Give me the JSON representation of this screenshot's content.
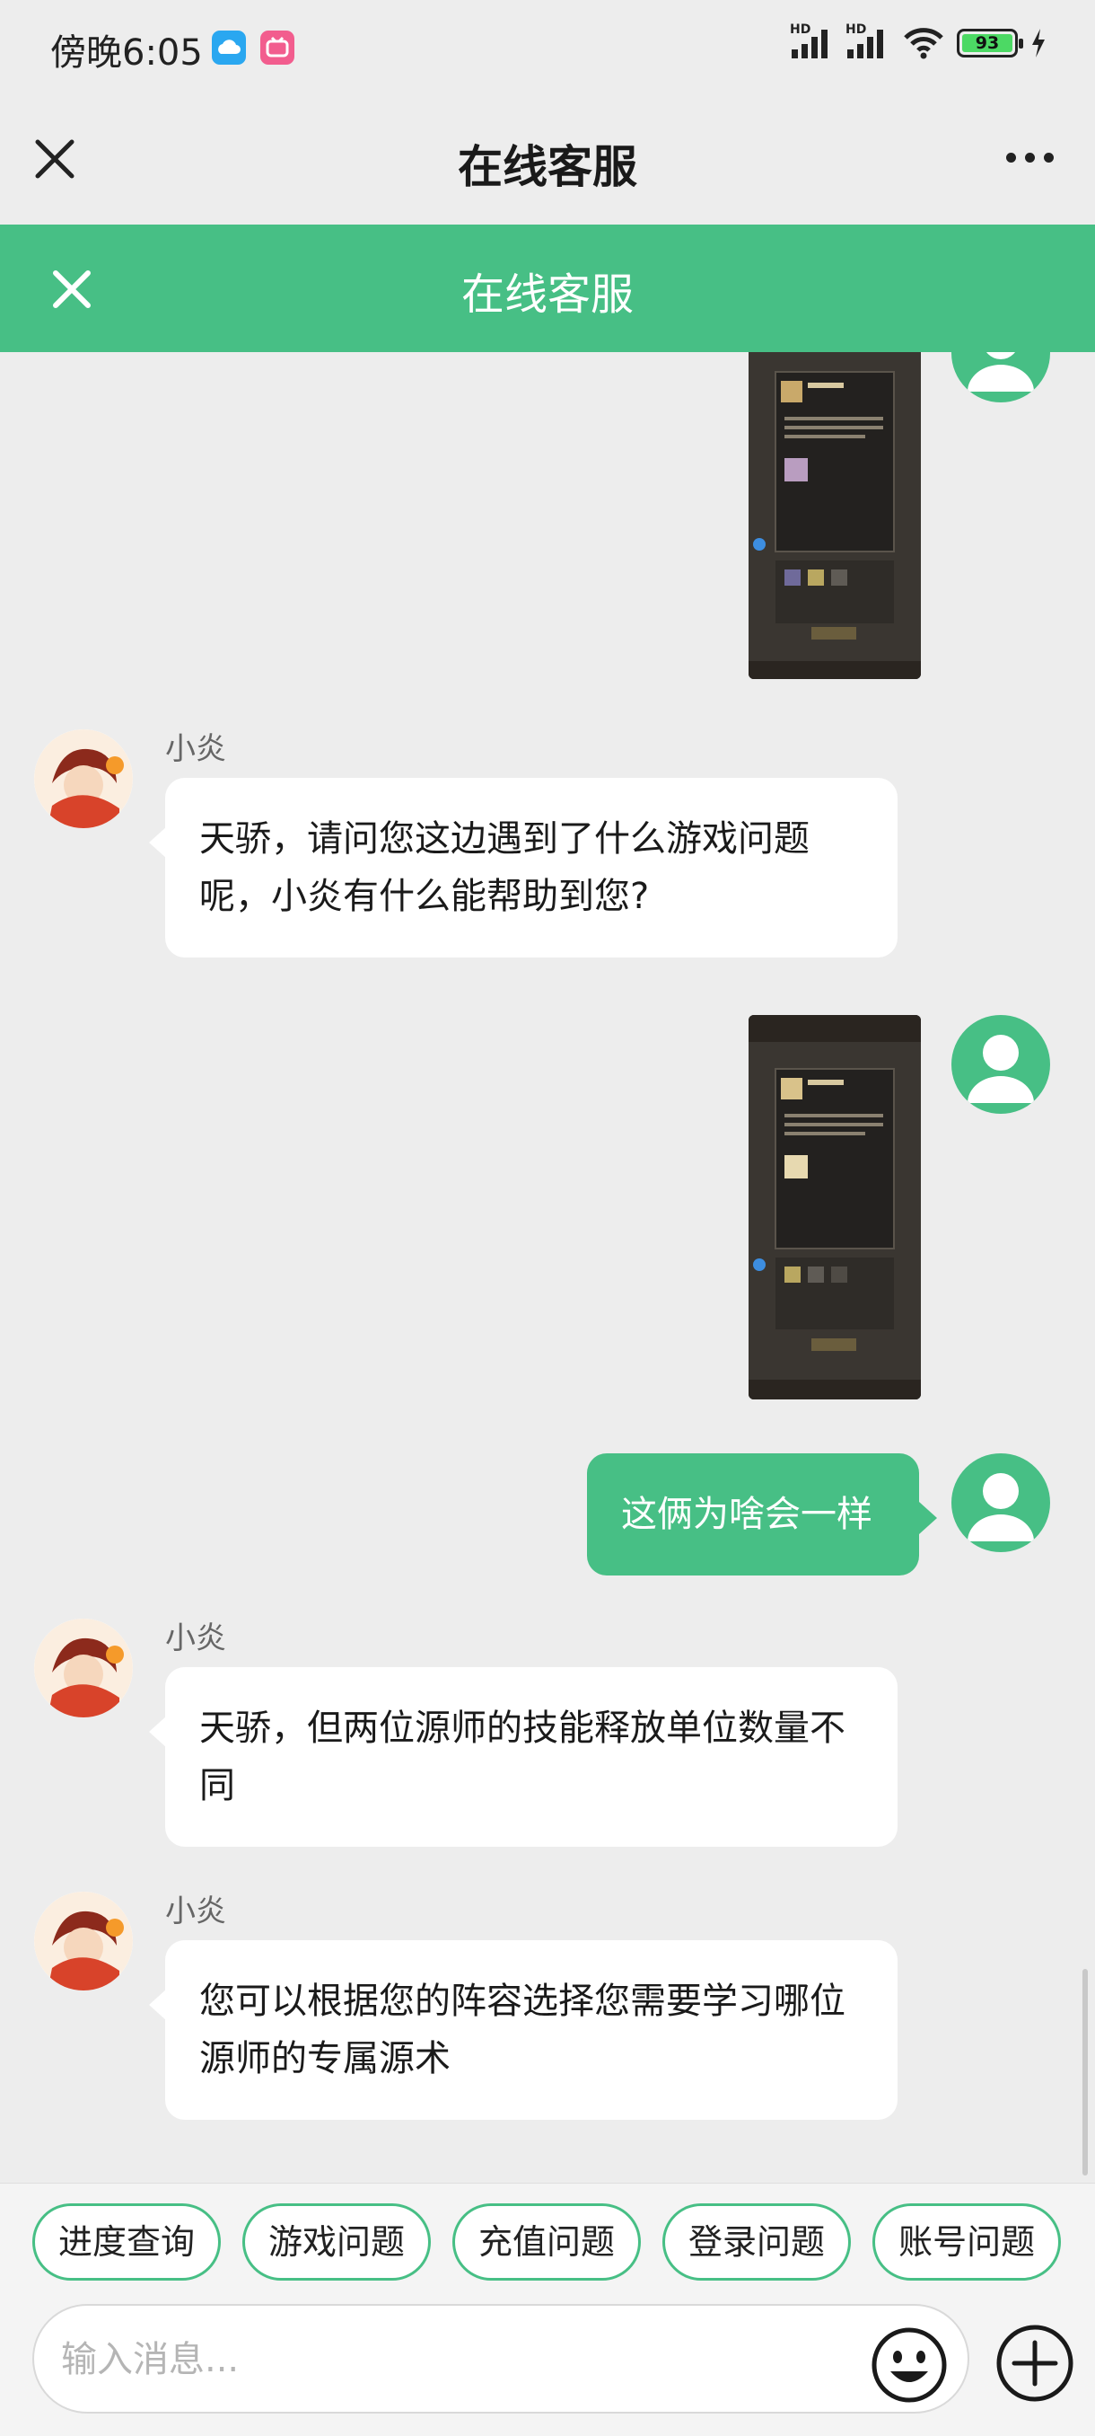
{
  "status_bar": {
    "time": "傍晚6:05",
    "battery": "93"
  },
  "topbar": {
    "title": "在线客服"
  },
  "service_header": {
    "title": "在线客服"
  },
  "messages": [
    {
      "sender": "小炎",
      "text": "天骄，请问您这边遇到了什么游戏问题呢，小炎有什么能帮助到您?"
    },
    {
      "sender": "user",
      "text": "这俩为啥会一样"
    },
    {
      "sender": "小炎",
      "text": "天骄，但两位源师的技能释放单位数量不同"
    },
    {
      "sender": "小炎",
      "text": "您可以根据您的阵容选择您需要学习哪位源师的专属源术"
    }
  ],
  "quick_replies": [
    "进度查询",
    "游戏问题",
    "充值问题",
    "登录问题",
    "账号问题"
  ],
  "input": {
    "placeholder": "输入消息..."
  },
  "colors": {
    "accent": "#47bf85",
    "background": "#ededed"
  }
}
